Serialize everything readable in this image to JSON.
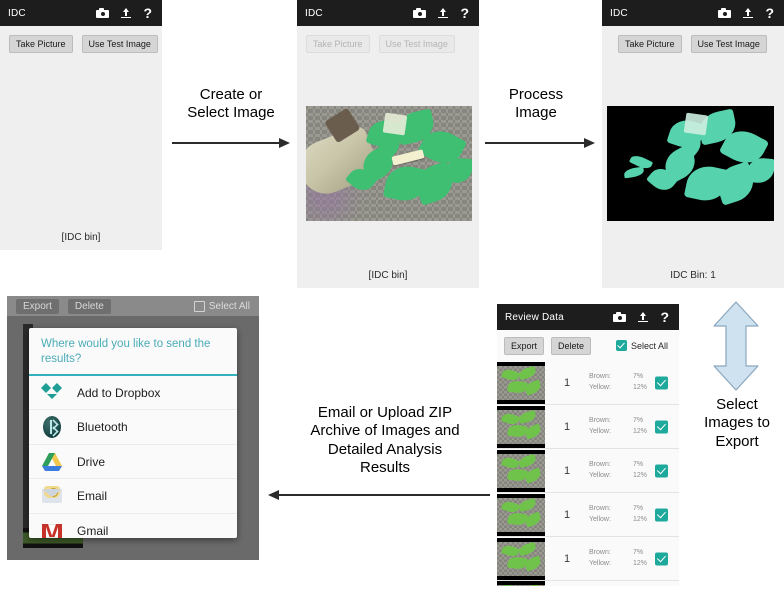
{
  "screens": {
    "capture_empty": {
      "appbar": {
        "title": "IDC",
        "icons": [
          "camera-icon",
          "upload-icon",
          "help-icon"
        ]
      },
      "buttons": {
        "take_picture": "Take Picture",
        "use_test_image": "Use Test Image"
      },
      "status": "[IDC bin]"
    },
    "capture_loaded": {
      "appbar": {
        "title": "IDC",
        "icons": [
          "camera-icon",
          "upload-icon",
          "help-icon"
        ]
      },
      "buttons": {
        "take_picture": "Take Picture",
        "use_test_image": "Use Test Image"
      },
      "status": "[IDC bin]"
    },
    "processed": {
      "appbar": {
        "title": "IDC",
        "icons": [
          "camera-icon",
          "upload-icon",
          "help-icon"
        ]
      },
      "buttons": {
        "take_picture": "Take Picture",
        "use_test_image": "Use Test Image"
      },
      "status": "IDC Bin: 1"
    },
    "review": {
      "appbar": {
        "title": "Review Data",
        "icons": [
          "camera-icon",
          "upload-icon",
          "help-icon"
        ]
      },
      "toolbar": {
        "export": "Export",
        "delete": "Delete",
        "select_all": "Select All",
        "select_all_checked": true
      },
      "rows": [
        {
          "count": "1",
          "brown_label": "Brown:",
          "brown_value": "7%",
          "yellow_label": "Yellow:",
          "yellow_value": "12%",
          "checked": true
        },
        {
          "count": "1",
          "brown_label": "Brown:",
          "brown_value": "7%",
          "yellow_label": "Yellow:",
          "yellow_value": "12%",
          "checked": true
        },
        {
          "count": "1",
          "brown_label": "Brown:",
          "brown_value": "7%",
          "yellow_label": "Yellow:",
          "yellow_value": "12%",
          "checked": true
        },
        {
          "count": "1",
          "brown_label": "Brown:",
          "brown_value": "7%",
          "yellow_label": "Yellow:",
          "yellow_value": "12%",
          "checked": true
        },
        {
          "count": "1",
          "brown_label": "Brown:",
          "brown_value": "7%",
          "yellow_label": "Yellow:",
          "yellow_value": "12%",
          "checked": true
        }
      ]
    },
    "export_dialog": {
      "toolbar": {
        "export": "Export",
        "delete": "Delete",
        "select_all": "Select All",
        "select_all_checked": false
      },
      "prompt": "Where would you like to send the results?",
      "options": [
        {
          "label": "Add to Dropbox",
          "icon": "dropbox-icon"
        },
        {
          "label": "Bluetooth",
          "icon": "bluetooth-icon"
        },
        {
          "label": "Drive",
          "icon": "google-drive-icon"
        },
        {
          "label": "Email",
          "icon": "email-icon"
        },
        {
          "label": "Gmail",
          "icon": "gmail-icon"
        }
      ]
    }
  },
  "flow": {
    "create_or_select": "Create or\nSelect Image",
    "create_or_select_l1": "Create or",
    "create_or_select_l2": "Select Image",
    "process_image_l1": "Process",
    "process_image_l2": "Image",
    "email_upload_l1": "Email or Upload ZIP",
    "email_upload_l2": "Archive of Images and",
    "email_upload_l3": "Detailed Analysis",
    "email_upload_l4": "Results",
    "select_export_l1": "Select",
    "select_export_l2": "Images to",
    "select_export_l3": "Export"
  },
  "colors": {
    "accent_teal": "#35b0bd",
    "checkbox_teal": "#1ea99d",
    "appbar_dark": "#1d1d1d",
    "screen_bg": "#efefef",
    "arrow_fill": "#cfe2f0",
    "gmail_red": "#c5322a",
    "dropbox_teal": "#1f9e96"
  }
}
